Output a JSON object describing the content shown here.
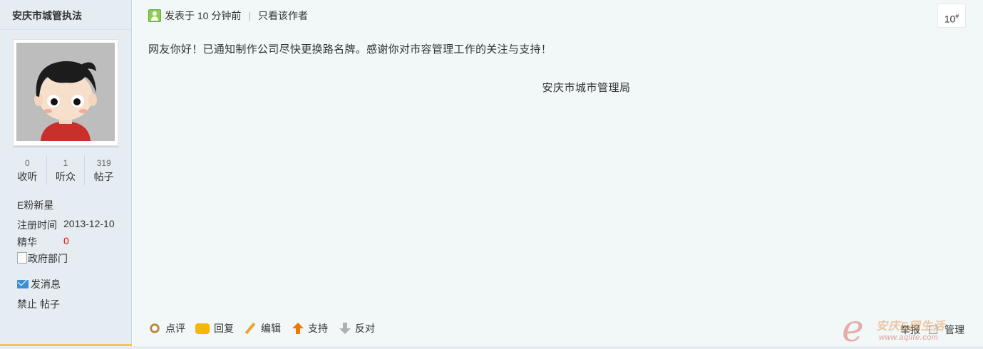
{
  "author": {
    "name": "安庆市城管执法",
    "stats": [
      {
        "value": "0",
        "label": "收听"
      },
      {
        "value": "1",
        "label": "听众"
      },
      {
        "value": "319",
        "label": "帖子"
      }
    ],
    "rank": "E粉新星",
    "reg_label": "注册时间",
    "reg_value": "2013-12-10",
    "digest_label": "精华",
    "digest_value": "0",
    "badge": "政府部门",
    "send_message": "发消息",
    "ban": "禁止",
    "posts": "帖子"
  },
  "post": {
    "posted": "发表于 10 分钟前",
    "separator": "|",
    "author_only": "只看该作者",
    "floor": "10",
    "floor_mark": "#",
    "body": "网友你好！已通知制作公司尽快更换路名牌。感谢你对市容管理工作的关注与支持！",
    "signature": "安庆市城市管理局"
  },
  "actions": {
    "comment": "点评",
    "reply": "回复",
    "edit": "编辑",
    "support": "支持",
    "oppose": "反对",
    "report": "举报",
    "manage": "管理"
  },
  "watermark": {
    "letter": "e",
    "cn": "安庆E网生活",
    "site": "www.aqlife.com"
  },
  "colors": {
    "sidebar_bg": "#e5edf2",
    "main_bg": "#f2f7f8",
    "accent": "#f9c15d",
    "digest_value": "#ff0000"
  }
}
